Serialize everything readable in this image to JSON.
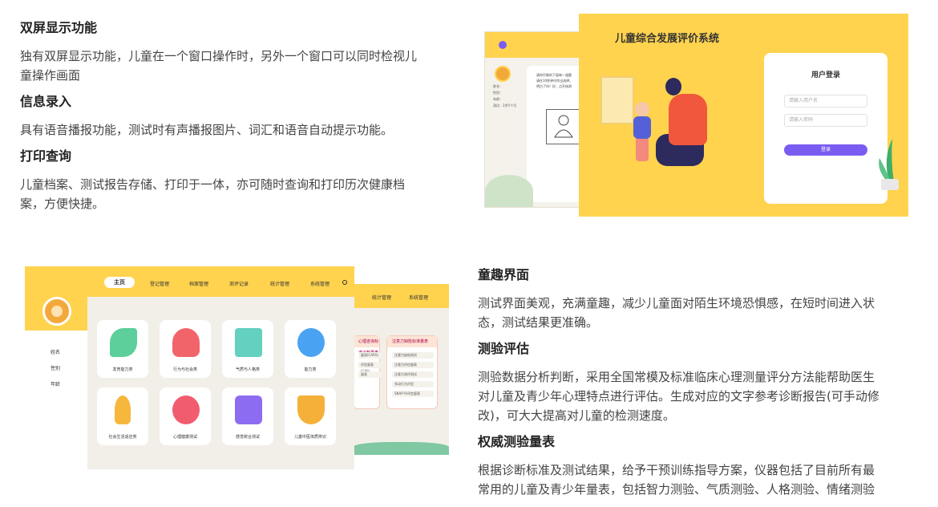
{
  "section1": {
    "features": [
      {
        "title": "双屏显示功能",
        "desc": [
          "独有双屏显示功能，儿童在一个窗口操作时，另外一个窗口可以同时检视儿",
          "童操作画面"
        ]
      },
      {
        "title": "信息录入",
        "desc": [
          "具有语音播报功能，测试时有声播报图片、词汇和语音自动提示功能。"
        ]
      },
      {
        "title": "打印查询",
        "desc": [
          "儿童档案、测试报告存储、打印于一体，亦可随时查询和打印历次健康档",
          "案，方便快捷。"
        ]
      }
    ]
  },
  "section2": {
    "features": [
      {
        "title": "童趣界面",
        "desc": [
          "测试界面美观，充满童趣，减少儿童面对陌生环境恐惧感，在短时间进入状",
          "态，测试结果更准确。"
        ]
      },
      {
        "title": "测验评估",
        "desc": [
          "测验数据分析判断，采用全国常模及标准临床心理测量评分方法能帮助医生",
          "对儿童及青少年心理特点进行评估。生成对应的文字参考诊断报告(可手动修",
          "改)，可大大提高对儿童的检测速度。"
        ]
      },
      {
        "title": "权威测验量表",
        "desc": [
          "根据诊断标准及测试结果，给予干预训练指导方案，仪器包括了目前所有最",
          "常用的儿童及青少年量表，包括智力测验、气质测验、人格测验、情绪测验"
        ]
      }
    ]
  },
  "screenshot_login": {
    "back_text": [
      "请你仔细听下面每一道题",
      "请在10秒钟内作出选择。",
      "明白了吗？好，点开始测"
    ],
    "info_labels": [
      "姓名：",
      "性别：",
      "年龄：",
      "测试：2岁5个月"
    ],
    "title": "儿童综合发展评价系统",
    "login_title": "用户登录",
    "username_placeholder": "请输入用户名",
    "password_placeholder": "请输入密码",
    "login_button": "登录",
    "colors": {
      "bg": "#ffd34e",
      "accent": "#7b5cf0"
    }
  },
  "screenshot_home": {
    "nav": [
      "主页",
      "登记管理",
      "档案管理",
      "测评记录",
      "统计管理",
      "系统管理"
    ],
    "back_nav": [
      "统计管理",
      "系统管理"
    ],
    "sidebar": [
      "姓名",
      "性别",
      "年龄"
    ],
    "cards": [
      {
        "label": "发育能力类",
        "icon": "leaf-icon",
        "color": "#5ccf9a"
      },
      {
        "label": "行为与社会类",
        "icon": "child-icon",
        "color": "#f1656a"
      },
      {
        "label": "气质与人格类",
        "icon": "book-icon",
        "color": "#63d0c0"
      },
      {
        "label": "能力类",
        "icon": "lightbulb-icon",
        "color": "#4aa3f2"
      },
      {
        "label": "社会生活适应类",
        "icon": "microphone-icon",
        "color": "#f6b73c"
      },
      {
        "label": "心理健康测试",
        "icon": "heart-icon",
        "color": "#f15c6e"
      },
      {
        "label": "感觉统合测试",
        "icon": "puzzle-icon",
        "color": "#8c6cf0"
      },
      {
        "label": "儿童中医体质辨识",
        "icon": "bowl-icon",
        "color": "#f5b03a"
      }
    ],
    "back_cards": [
      {
        "title": "心理咨询标准诊断量表",
        "items": [
          "量表(CARS)",
          "评定量表(CAS)",
          "量表"
        ]
      },
      {
        "title": "注意力缺陷标准量表",
        "items": [
          "注意力缺陷测试",
          "注意力评估量表",
          "注意力测评测试",
          "多动行为评定",
          "SNAP-IV评定量表"
        ]
      }
    ]
  }
}
